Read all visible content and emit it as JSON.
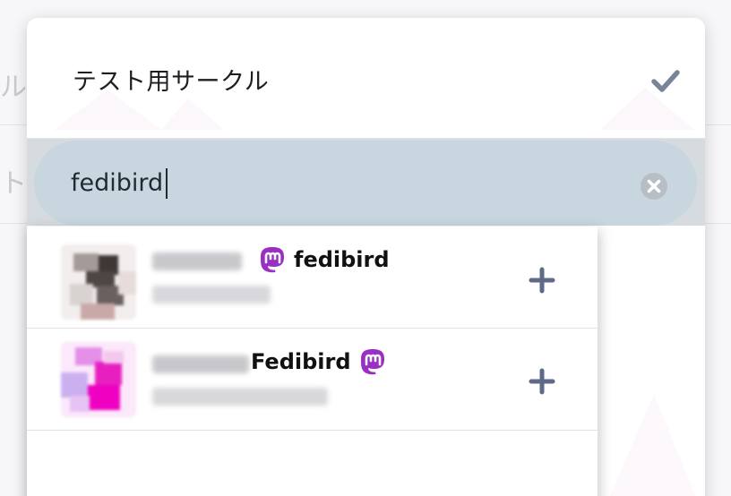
{
  "background": {
    "row1_fragment": "ル",
    "row2_fragment": "ト"
  },
  "modal": {
    "title": "テスト用サークル",
    "confirm_icon": "checkmark-icon",
    "search": {
      "value": "fedibird",
      "clear_icon": "clear-circle-icon"
    },
    "results": [
      {
        "display_name_suffix": "fedibird",
        "badge_icon": "mastodon-icon",
        "add_icon": "plus-icon"
      },
      {
        "display_name_suffix": "Fedibird",
        "badge_icon": "mastodon-icon",
        "add_icon": "plus-icon"
      }
    ]
  },
  "colors": {
    "accent_purple": "#9a2fc4",
    "icon_gray": "#5e6a86",
    "search_bg": "#c8d6df"
  }
}
